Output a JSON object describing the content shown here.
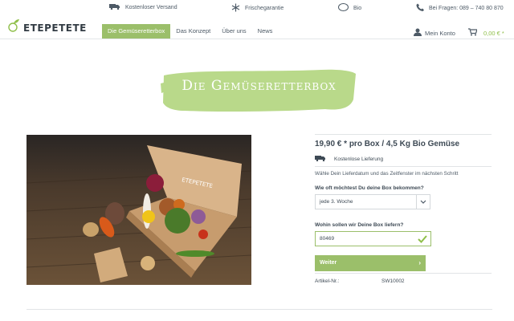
{
  "topbar": {
    "items": [
      {
        "label": "Kostenloser Versand",
        "icon": "truck-icon"
      },
      {
        "label": "Frischegarantie",
        "icon": "snowflake-icon"
      },
      {
        "label": "Bio",
        "icon": "bio-seal-icon",
        "seal_text": "BIO"
      },
      {
        "label": "Bei Fragen: 089 – 740 80 870",
        "icon": "phone-icon"
      }
    ]
  },
  "header": {
    "logo_text": "ETEPETETE",
    "nav": [
      {
        "label": "Die Gemüseretterbox",
        "active": true
      },
      {
        "label": "Das Konzept"
      },
      {
        "label": "Über uns"
      },
      {
        "label": "News"
      }
    ],
    "account_label": "Mein Konto",
    "cart_total": "0,00 € *"
  },
  "hero": {
    "title": "Die Gemüseretterbox",
    "stroke_color": "#b9d98a"
  },
  "product": {
    "image_box_text": "ETEPETETE",
    "price_line": "19,90 € * pro Box / 4,5 Kg Bio Gemüse",
    "shipping": "Kostenlose Lieferung",
    "hint": "Wähle Dein Lieferdatum und das Zeitfenster im nächsten Schritt",
    "frequency_label": "Wie oft möchtest Du deine Box bekommen?",
    "frequency_value": "jede 3. Woche",
    "zip_label": "Wohin sollen wir Deine Box liefern?",
    "zip_value": "80469",
    "button_label": "Weiter",
    "article_label": "Artikel-Nr.:",
    "article_value": "SW10002"
  },
  "colors": {
    "accent_green": "#9bbf6a",
    "text_dark": "#3e4a55"
  }
}
